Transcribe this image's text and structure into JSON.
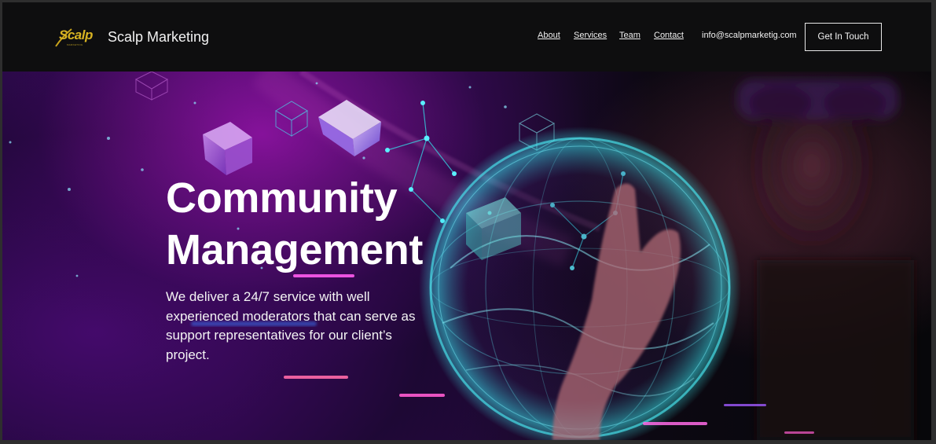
{
  "header": {
    "logo": {
      "text": "Scalp",
      "subtext": "MARKETING"
    },
    "brand_name": "Scalp Marketing",
    "nav": [
      {
        "label": "About"
      },
      {
        "label": "Services"
      },
      {
        "label": "Team"
      },
      {
        "label": "Contact"
      }
    ],
    "email": "info@scalpmarketig.com",
    "cta_label": "Get In Touch"
  },
  "hero": {
    "title_line1": "Community",
    "title_line2": "Management",
    "description": "We deliver a 24/7 service with well experienced moderators that can serve as support representatives for our client’s project."
  },
  "colors": {
    "header_bg": "#0e0e0f",
    "logo_gold": "#d8b322",
    "accent_purple": "#8a1fb0",
    "accent_cyan": "#3ee6e6",
    "accent_pink": "#e23cc9"
  }
}
